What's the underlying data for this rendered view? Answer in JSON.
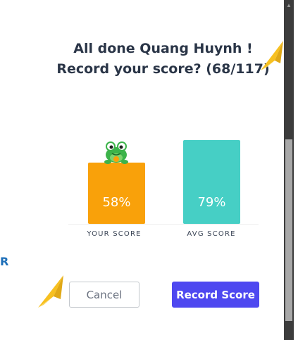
{
  "dialog": {
    "title_line1": "All done Quang Huynh !",
    "title_line2": "Record your score? (68/117)"
  },
  "chart_data": {
    "type": "bar",
    "categories": [
      "YOUR SCORE",
      "AVG SCORE"
    ],
    "values": [
      58,
      79
    ],
    "value_labels": [
      "58%",
      "79%"
    ],
    "ylim": [
      0,
      100
    ],
    "colors": [
      "#f9a10a",
      "#46cfc5"
    ]
  },
  "side_text": "R",
  "buttons": {
    "cancel_label": "Cancel",
    "record_label": "Record Score",
    "record_color": "#4e48f0"
  },
  "icons": {
    "mascot": "frog-mascot-icon",
    "decoration": "paper-plane-icon"
  }
}
